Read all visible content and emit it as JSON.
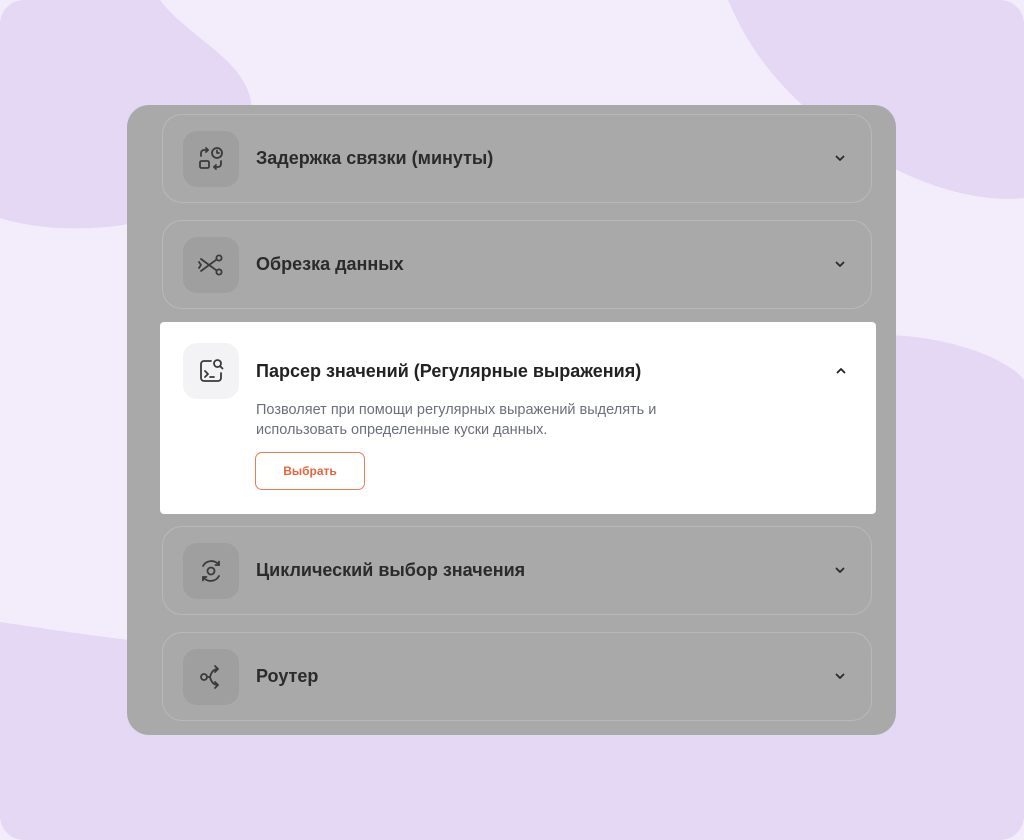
{
  "background": {
    "color": "#f3edfb",
    "blob_color": "#e4d8f4"
  },
  "panel": {
    "overlay_color": "#a9a9a9"
  },
  "accordion": {
    "items": [
      {
        "title": "Задержка связки (минуты)",
        "icon": "delay-clock-icon",
        "expanded": false
      },
      {
        "title": "Обрезка данных",
        "icon": "scissors-icon",
        "expanded": false
      },
      {
        "title": "Парсер значений (Регулярные выражения)",
        "icon": "regex-parser-icon",
        "expanded": true,
        "description": "Позволяет при помощи регулярных выражений выделять и использовать определенные куски данных.",
        "button_label": "Выбрать"
      },
      {
        "title": "Циклический выбор значения",
        "icon": "cycle-icon",
        "expanded": false
      },
      {
        "title": "Роутер",
        "icon": "router-icon",
        "expanded": false
      }
    ]
  },
  "colors": {
    "accent": "#e8643a",
    "title_text": "#222222",
    "description_text": "#6b6f7b"
  }
}
